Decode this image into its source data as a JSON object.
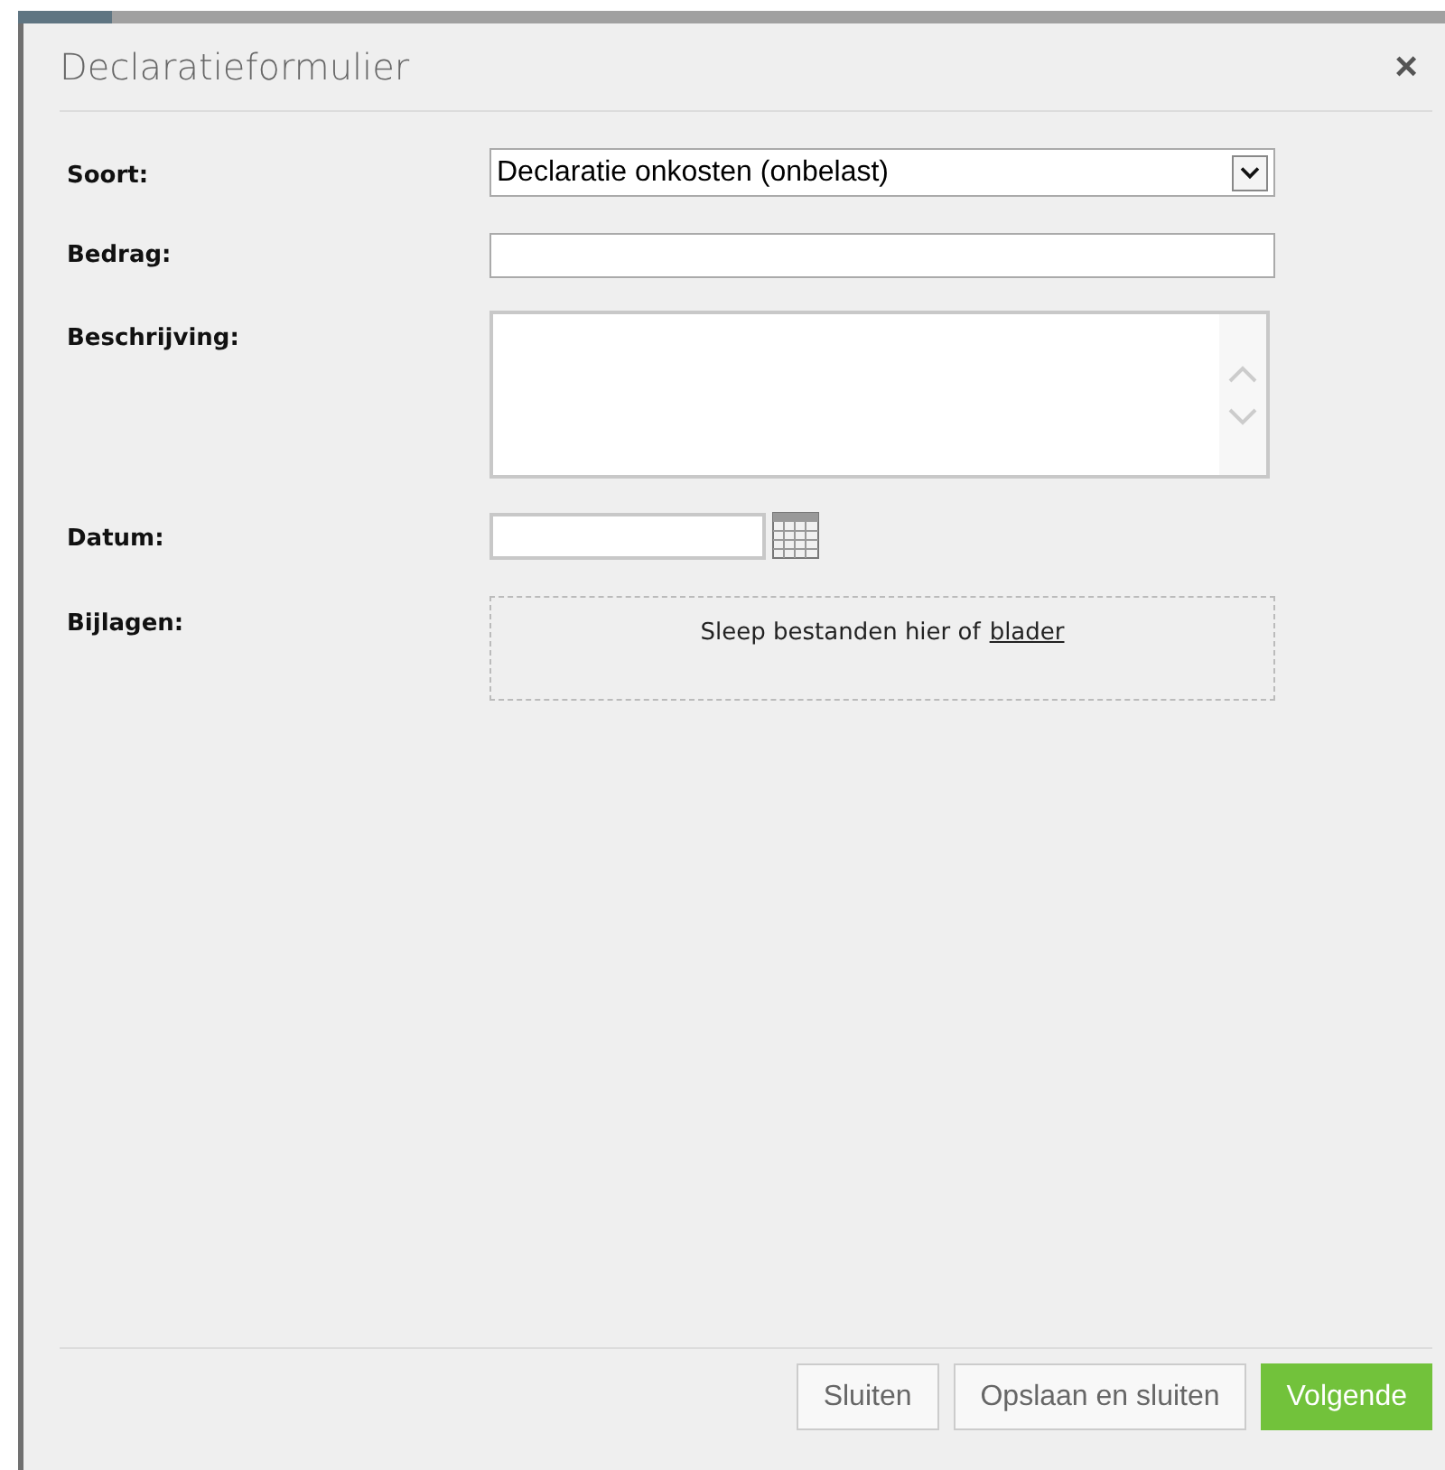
{
  "dialog": {
    "title": "Declaratieformulier",
    "close": "×"
  },
  "fields": [
    {
      "kind": "select",
      "label": "Soort:",
      "value": "Declaratie onkosten (onbelast)"
    },
    {
      "kind": "text",
      "label": "Bedrag:"
    },
    {
      "kind": "textarea",
      "label": "Beschrijving:"
    },
    {
      "kind": "date",
      "label": "Datum:"
    },
    {
      "kind": "dropzone",
      "label": "Bijlagen:",
      "text": "Sleep bestanden hier of",
      "link": "blader"
    }
  ],
  "buttons": [
    {
      "label": "Sluiten",
      "primary": false
    },
    {
      "label": "Opslaan en sluiten",
      "primary": false
    },
    {
      "label": "Volgende",
      "primary": true
    }
  ]
}
